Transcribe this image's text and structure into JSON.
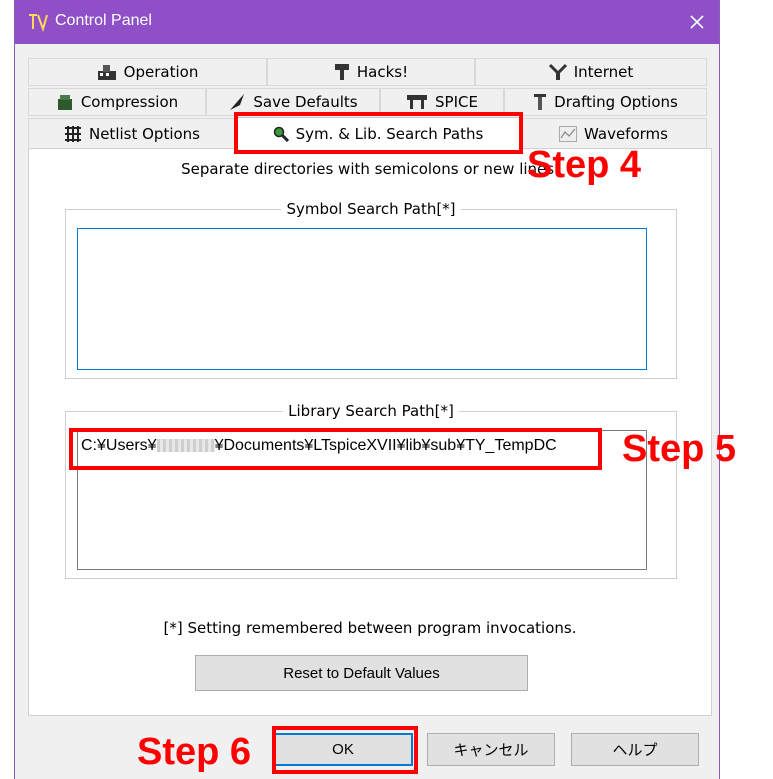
{
  "window": {
    "title": "Control Panel",
    "app_icon": "ltspice-app-icon",
    "close_icon": "close-icon"
  },
  "tabs": {
    "row1": [
      {
        "label": "Operation",
        "icon": "operation-icon"
      },
      {
        "label": "Hacks!",
        "icon": "hacks-icon"
      },
      {
        "label": "Internet",
        "icon": "internet-icon"
      }
    ],
    "row2": [
      {
        "label": "Compression",
        "icon": "compression-icon"
      },
      {
        "label": "Save Defaults",
        "icon": "quill-icon"
      },
      {
        "label": "SPICE",
        "icon": "spice-icon"
      },
      {
        "label": "Drafting Options",
        "icon": "drafting-icon"
      }
    ],
    "row3": [
      {
        "label": "Netlist Options",
        "icon": "netlist-icon"
      },
      {
        "label": "Sym. & Lib. Search Paths",
        "icon": "magnifier-icon",
        "selected": true
      },
      {
        "label": "Waveforms",
        "icon": "waveforms-icon"
      }
    ]
  },
  "panel": {
    "instruction": "Separate directories with semicolons or new lines.",
    "symbol_group_label": "Symbol Search Path[*]",
    "symbol_path_value": "",
    "library_group_label": "Library Search Path[*]",
    "library_path_prefix": "C:¥Users¥",
    "library_path_suffix": "¥Documents¥LTspiceXVII¥lib¥sub¥TY_TempDC",
    "footnote": "[*] Setting remembered between program invocations.",
    "reset_button": "Reset to Default Values"
  },
  "buttons": {
    "ok": "OK",
    "cancel": "キャンセル",
    "help": "ヘルプ"
  },
  "annotations": {
    "step4": "Step 4",
    "step5": "Step 5",
    "step6": "Step 6",
    "color": "#ff0000"
  }
}
